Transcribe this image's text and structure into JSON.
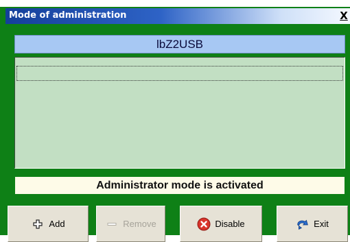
{
  "window": {
    "title": "Mode of administration",
    "close_label": "X"
  },
  "device": {
    "name": "lbZ2USB"
  },
  "list": {
    "items": [
      ""
    ]
  },
  "status": {
    "text": "Administrator mode is activated"
  },
  "buttons": {
    "add_label": "Add",
    "remove_label": "Remove",
    "disable_label": "Disable",
    "exit_label": "Exit"
  },
  "icons": {
    "add": "plus-icon",
    "remove": "minus-icon",
    "disable": "red-x-circle-icon",
    "exit": "blue-arrow-icon"
  },
  "colors": {
    "frame": "#0e8016",
    "header": "#a7c8f3",
    "list": "#c2dfc3",
    "status": "#fefbe8",
    "button": "#e6e2d6"
  }
}
